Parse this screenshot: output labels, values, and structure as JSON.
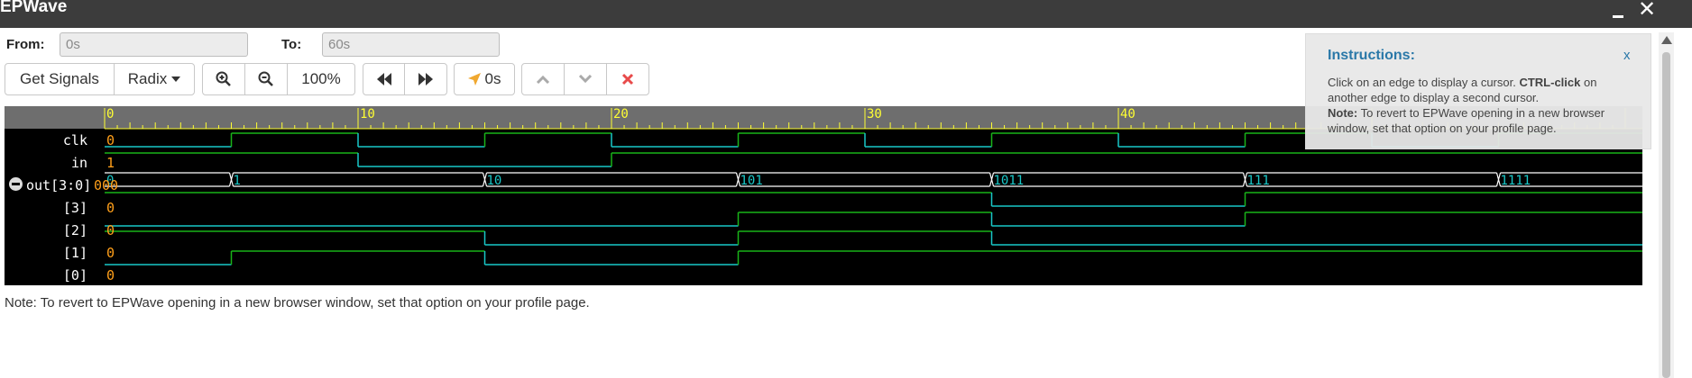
{
  "window": {
    "title": "EPWave",
    "minimize": "_",
    "close": "✕"
  },
  "range": {
    "from_label": "From:",
    "from_value": "0s",
    "to_label": "To:",
    "to_value": "60s"
  },
  "toolbar": {
    "get_signals": "Get Signals",
    "radix": "Radix",
    "zoom_in_icon": "zoom-in-icon",
    "zoom_out_icon": "zoom-out-icon",
    "zoom_level": "100%",
    "prev_edge_icon": "rewind-icon",
    "next_edge_icon": "fast-forward-icon",
    "cursor_time": "0s",
    "up_icon": "chevron-up-icon",
    "down_icon": "chevron-down-icon",
    "delete_icon": "close-icon",
    "accent": "#e84a4a"
  },
  "ruler": {
    "labels": [
      "0",
      "10",
      "20",
      "30",
      "40"
    ],
    "start": 0,
    "end": 60,
    "color": "#ffff33"
  },
  "signals": [
    {
      "name": "clk",
      "value": "0",
      "type": "bit",
      "transitions": [
        [
          0,
          0
        ],
        [
          5,
          1
        ],
        [
          10,
          0
        ],
        [
          15,
          1
        ],
        [
          20,
          0
        ],
        [
          25,
          1
        ],
        [
          30,
          0
        ],
        [
          35,
          1
        ],
        [
          40,
          0
        ],
        [
          45,
          1
        ],
        [
          50,
          0
        ],
        [
          55,
          1
        ]
      ]
    },
    {
      "name": "in",
      "value": "1",
      "type": "bit",
      "transitions": [
        [
          0,
          1
        ],
        [
          10,
          0
        ],
        [
          20,
          1
        ]
      ]
    },
    {
      "name": "out[3:0]",
      "value": "000",
      "type": "bus",
      "expandable": true,
      "segments": [
        [
          0,
          "0"
        ],
        [
          5,
          "1"
        ],
        [
          15,
          "10"
        ],
        [
          25,
          "101"
        ],
        [
          35,
          "1011"
        ],
        [
          45,
          "111"
        ],
        [
          55,
          "1111"
        ]
      ]
    },
    {
      "name": "[3]",
      "value": "0",
      "type": "bit",
      "transitions": [
        [
          0,
          1
        ],
        [
          35,
          0
        ],
        [
          45,
          1
        ]
      ]
    },
    {
      "name": "[2]",
      "value": "0",
      "type": "bit",
      "transitions": [
        [
          0,
          0
        ],
        [
          25,
          1
        ],
        [
          35,
          0
        ],
        [
          45,
          1
        ]
      ]
    },
    {
      "name": "[1]",
      "value": "0",
      "type": "bit",
      "transitions": [
        [
          0,
          1
        ],
        [
          15,
          0
        ],
        [
          25,
          1
        ],
        [
          35,
          0
        ]
      ]
    },
    {
      "name": "[0]",
      "value": "0",
      "type": "bit",
      "transitions": [
        [
          0,
          0
        ],
        [
          5,
          1
        ],
        [
          15,
          0
        ],
        [
          25,
          1
        ]
      ]
    }
  ],
  "colors": {
    "high": "#19b419",
    "low": "#19c8c8",
    "bus": "#ffffff",
    "bus_text": "#19c8c8",
    "value": "#ff9f1a"
  },
  "note": "Note: To revert to EPWave opening in a new browser window, set that option on your profile page.",
  "instructions": {
    "title": "Instructions:",
    "close": "x",
    "line1_a": "Click on an edge to display a cursor. ",
    "line1_b": "CTRL-click",
    "line1_c": " on another edge to display a second cursor.",
    "note_b": "Note:",
    "note_text": " To revert to EPWave opening in a new browser window, set that option on your profile page."
  }
}
